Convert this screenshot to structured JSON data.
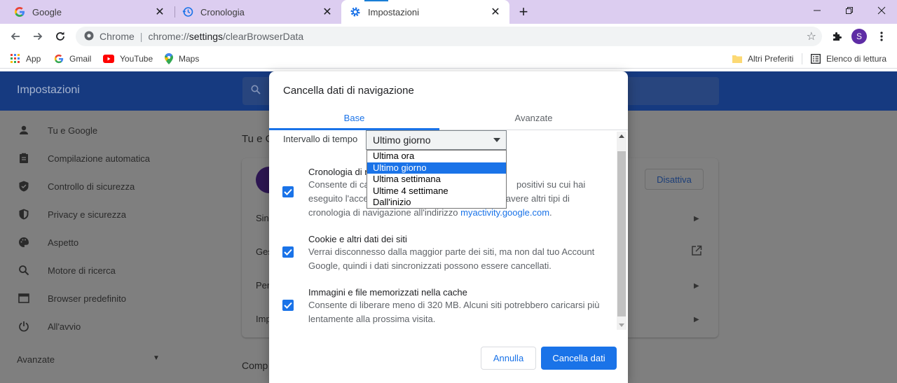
{
  "tabs": [
    {
      "title": "Google",
      "icon": "google-icon"
    },
    {
      "title": "Cronologia",
      "icon": "history-icon"
    },
    {
      "title": "Impostazioni",
      "icon": "settings-icon",
      "active": true
    }
  ],
  "omnibox": {
    "site": "Chrome",
    "url_prefix": "chrome://",
    "url_host": "settings",
    "url_path": "/clearBrowserData"
  },
  "profile_initial": "S",
  "bookmarks": {
    "items": [
      {
        "label": "App",
        "icon": "apps-grid-icon"
      },
      {
        "label": "Gmail",
        "icon": "google-icon"
      },
      {
        "label": "YouTube",
        "icon": "youtube-icon"
      },
      {
        "label": "Maps",
        "icon": "maps-pin-icon"
      }
    ],
    "other": "Altri Preferiti",
    "reading_list": "Elenco di lettura"
  },
  "settings": {
    "title": "Impostazioni",
    "sidebar": [
      {
        "label": "Tu e Google",
        "icon": "person-icon"
      },
      {
        "label": "Compilazione automatica",
        "icon": "clipboard-icon"
      },
      {
        "label": "Controllo di sicurezza",
        "icon": "shield-check-icon"
      },
      {
        "label": "Privacy e sicurezza",
        "icon": "shield-icon"
      },
      {
        "label": "Aspetto",
        "icon": "palette-icon"
      },
      {
        "label": "Motore di ricerca",
        "icon": "search-icon"
      },
      {
        "label": "Browser predefinito",
        "icon": "browser-icon"
      },
      {
        "label": "All'avvio",
        "icon": "power-icon"
      }
    ],
    "advanced": "Avanzate",
    "section_title": "Tu e G",
    "turn_off": "Disattiva",
    "rows": [
      "Sinc",
      "Ges",
      "Per",
      "Imp"
    ],
    "bottom_section": "Comp"
  },
  "dialog": {
    "title": "Cancella dati di navigazione",
    "tab_basic": "Base",
    "tab_advanced": "Avanzate",
    "time_range_label": "Intervallo di tempo",
    "time_range_value": "Ultimo giorno",
    "time_range_options": [
      "Ultima ora",
      "Ultimo giorno",
      "Ultima settimana",
      "Ultime 4 settimane",
      "Dall'inizio"
    ],
    "items": [
      {
        "title": "Cronologia di n",
        "desc_1": "Consente di ca",
        "desc_1_tail": "positivi su cui hai",
        "desc_2": "eseguito l'acce",
        "desc_2_tail": "e avere altri tipi di",
        "desc_3": "cronologia di navigazione all'indirizzo ",
        "link": "myactivity.google.com",
        "desc_3_end": ".",
        "checked": true
      },
      {
        "title": "Cookie e altri dati dei siti",
        "desc": "Verrai disconnesso dalla maggior parte dei siti, ma non dal tuo Account Google, quindi i dati sincronizzati possono essere cancellati.",
        "checked": true
      },
      {
        "title": "Immagini e file memorizzati nella cache",
        "desc": "Consente di liberare meno di 320 MB. Alcuni siti potrebbero caricarsi più lentamente alla prossima visita.",
        "checked": true
      }
    ],
    "cancel": "Annulla",
    "confirm": "Cancella dati"
  },
  "colors": {
    "accent": "#1a73e8",
    "header": "#163a80",
    "tabstrip": "#dccdf0"
  }
}
